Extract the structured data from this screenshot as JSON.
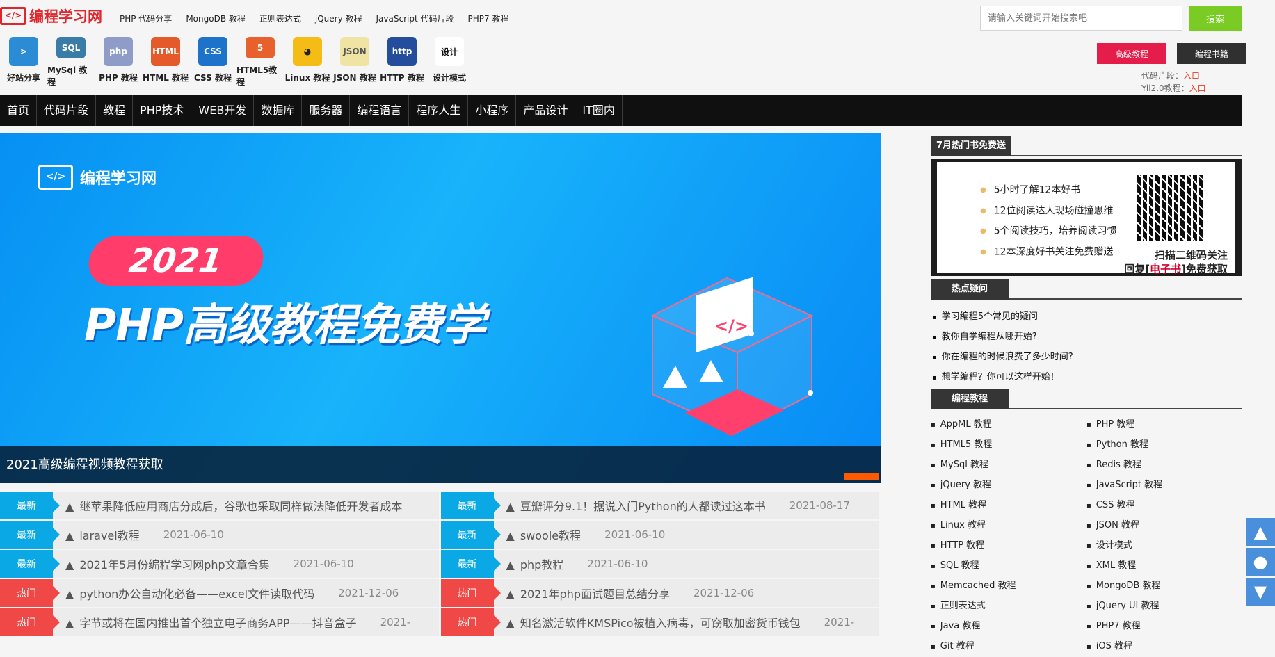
{
  "brand": {
    "logo_text": "编程学习网",
    "logo_icon": "code-brackets-icon"
  },
  "top_links": [
    "PHP 代码分享",
    "MongoDB 教程",
    "正则表达式",
    "jQuery 教程",
    "JavaScript 代码片段",
    "PHP7 教程"
  ],
  "search": {
    "placeholder": "请输入关键词开始搜索吧",
    "button": "搜索"
  },
  "icon_shortcuts": [
    {
      "label": "好站分享",
      "icon": "share-icon",
      "color": "#2b8bd5"
    },
    {
      "label": "MySql 教程",
      "icon": "mysql-icon",
      "color": "#3a7ca8"
    },
    {
      "label": "PHP 教程",
      "icon": "php-icon",
      "color": "#8e9cc7"
    },
    {
      "label": "HTML 教程",
      "icon": "html-icon",
      "color": "#e55a2b"
    },
    {
      "label": "CSS 教程",
      "icon": "css-icon",
      "color": "#1d73c9"
    },
    {
      "label": "HTML5教程",
      "icon": "html5-icon",
      "color": "#e8612c"
    },
    {
      "label": "Linux 教程",
      "icon": "linux-penguin-icon",
      "color": "#f5bc16"
    },
    {
      "label": "JSON 教程",
      "icon": "json-icon",
      "color": "#efe4a4"
    },
    {
      "label": "HTTP 教程",
      "icon": "http-icon",
      "color": "#244e9b"
    },
    {
      "label": "设计模式",
      "icon": "design-pattern-icon",
      "color": "#ffffff"
    }
  ],
  "top_actions": [
    {
      "label": "高级教程",
      "color": "#e41d4b"
    },
    {
      "label": "编程书籍",
      "color": "#303030"
    }
  ],
  "scroll_links": [
    {
      "label": "代码片段：",
      "link": "入口"
    },
    {
      "label": "Yii2.0教程：",
      "link": "入口"
    }
  ],
  "nav": [
    "首页",
    "代码片段",
    "教程",
    "PHP技术",
    "WEB开发",
    "数据库",
    "服务器",
    "编程语言",
    "程序人生",
    "小程序",
    "产品设计",
    "IT圈内"
  ],
  "hero": {
    "brand_text": "编程学习网",
    "year": "2021",
    "title": "PHP高级教程免费学",
    "caption": "2021高级编程视频教程获取"
  },
  "news": [
    [
      {
        "badge": "最新",
        "type": "new",
        "title": "继苹果降低应用商店分成后，谷歌也采取同样做法降低开发者成本",
        "date": ""
      },
      {
        "badge": "最新",
        "type": "new",
        "title": "豆瓣评分9.1！据说入门Python的人都读过这本书",
        "date": "2021-08-17"
      }
    ],
    [
      {
        "badge": "最新",
        "type": "new",
        "title": "laravel教程",
        "date": "2021-06-10"
      },
      {
        "badge": "最新",
        "type": "new",
        "title": "swoole教程",
        "date": "2021-06-10"
      }
    ],
    [
      {
        "badge": "最新",
        "type": "new",
        "title": "2021年5月份编程学习网php文章合集",
        "date": "2021-06-10"
      },
      {
        "badge": "最新",
        "type": "new",
        "title": "php教程",
        "date": "2021-06-10"
      }
    ],
    [
      {
        "badge": "热门",
        "type": "hot",
        "title": "python办公自动化必备——excel文件读取代码",
        "date": "2021-12-06"
      },
      {
        "badge": "热门",
        "type": "hot",
        "title": "2021年php面试题目总结分享",
        "date": "2021-12-06"
      }
    ],
    [
      {
        "badge": "热门",
        "type": "hot",
        "title": "字节或将在国内推出首个独立电子商务APP——抖音盒子",
        "date": "2021-"
      },
      {
        "badge": "热门",
        "type": "hot",
        "title": "知名激活软件KMSPico被植入病毒，可窃取加密货币钱包",
        "date": "2021-"
      }
    ]
  ],
  "sidebar": {
    "promo": {
      "heading": "7月热门书免费送",
      "items": [
        "5小时了解12本好书",
        "12位阅读达人现场碰撞思维",
        "5个阅读技巧，培养阅读习惯",
        "12本深度好书关注免费赠送"
      ],
      "qr_text_1": "扫描二维码关注",
      "qr_text_2": "回复[",
      "qr_text_red": "电子书",
      "qr_text_3": "]免费获取"
    },
    "hot_questions": {
      "heading": "热点疑问",
      "items": [
        "学习编程5个常见的疑问",
        "教你自学编程从哪开始?",
        "你在编程的时候浪费了多少时间?",
        "想学编程？你可以这样开始！"
      ]
    },
    "tutorials": {
      "heading": "编程教程",
      "items": [
        "AppML 教程",
        "PHP 教程",
        "HTML5 教程",
        "Python 教程",
        "MySql 教程",
        "Redis 教程",
        "jQuery 教程",
        "JavaScript 教程",
        "HTML 教程",
        "CSS 教程",
        "Linux 教程",
        "JSON 教程",
        "HTTP 教程",
        "设计模式",
        "SQL 教程",
        "XML 教程",
        "Memcached 教程",
        "MongoDB 教程",
        "正则表达式",
        "jQuery UI 教程",
        "Java 教程",
        "PHP7 教程",
        "Git 教程",
        "iOS 教程"
      ]
    }
  },
  "floating_buttons": [
    "up-arrow-icon",
    "user-icon",
    "down-arrow-icon"
  ]
}
